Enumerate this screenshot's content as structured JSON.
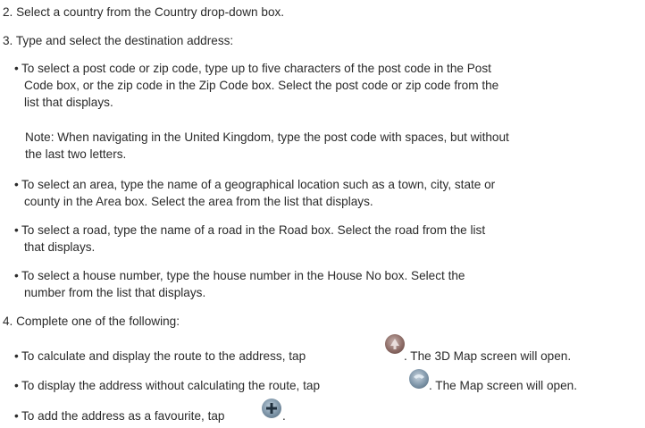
{
  "steps": {
    "s2": "2. Select a country from the Country drop-down box.",
    "s3": "3. Type and select the destination address:",
    "s4": "4. Complete one of the following:"
  },
  "bullets": {
    "postcode_1": "To select a post code or zip code, type up to five characters of the post code in the Post",
    "postcode_2": "Code box, or the zip code in the Zip Code box. Select the post code or zip code from the",
    "postcode_3": "list that displays.",
    "note_1": "Note: When navigating in the United Kingdom, type the post code with spaces, but without",
    "note_2": "the last two letters.",
    "area_1": "To select an area, type the name of a geographical location such as a town, city, state or",
    "area_2": "county in the Area box. Select the area from the list that displays.",
    "road_1": "To select a road, type the name of a road in the Road box. Select the road from the list",
    "road_2": "that displays.",
    "house_1": "To select a house number, type the house number in the House No box. Select the",
    "house_2": "number from the list that displays.",
    "calc_before": "To calculate and display the route to the address, tap",
    "calc_after": ". The 3D Map screen will open.",
    "display_before": "To display the address without calculating the route, tap",
    "display_after": ". The Map screen will open.",
    "fav_before": "To add the address as a favourite, tap",
    "fav_after": "."
  },
  "icons": {
    "go": "navigate-go-icon",
    "map": "map-view-icon",
    "fav": "add-favourite-icon"
  },
  "colors": {
    "text": "#2a2a2a"
  }
}
